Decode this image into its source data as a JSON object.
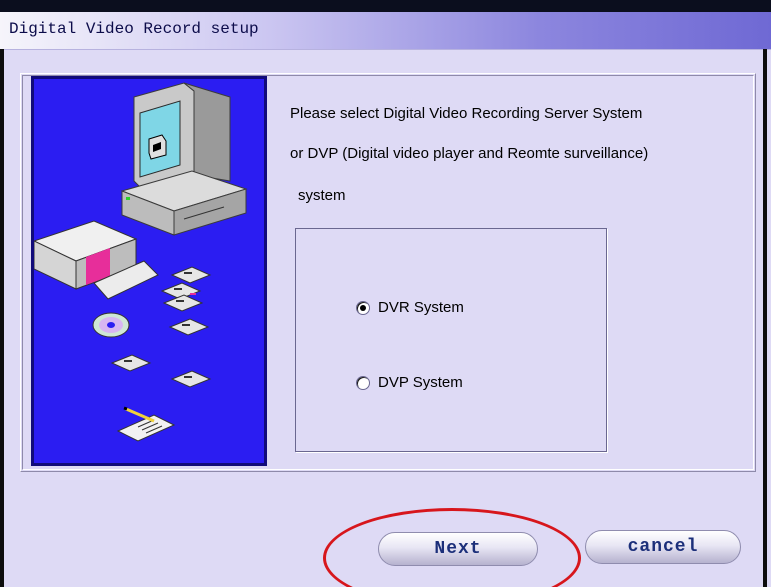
{
  "window": {
    "title": "Digital Video Record setup"
  },
  "prompt": {
    "line1": "Please select Digital Video Recording Server System",
    "line2": "or DVP (Digital video player and Reomte  surveillance)",
    "line3": "system"
  },
  "options": [
    {
      "label": "DVR System",
      "selected": true
    },
    {
      "label": "DVP  System",
      "selected": false
    }
  ],
  "buttons": {
    "next": "Next",
    "cancel": "cancel"
  },
  "colors": {
    "highlight": "#d7161c",
    "illustration_bg": "#2b1df2"
  }
}
